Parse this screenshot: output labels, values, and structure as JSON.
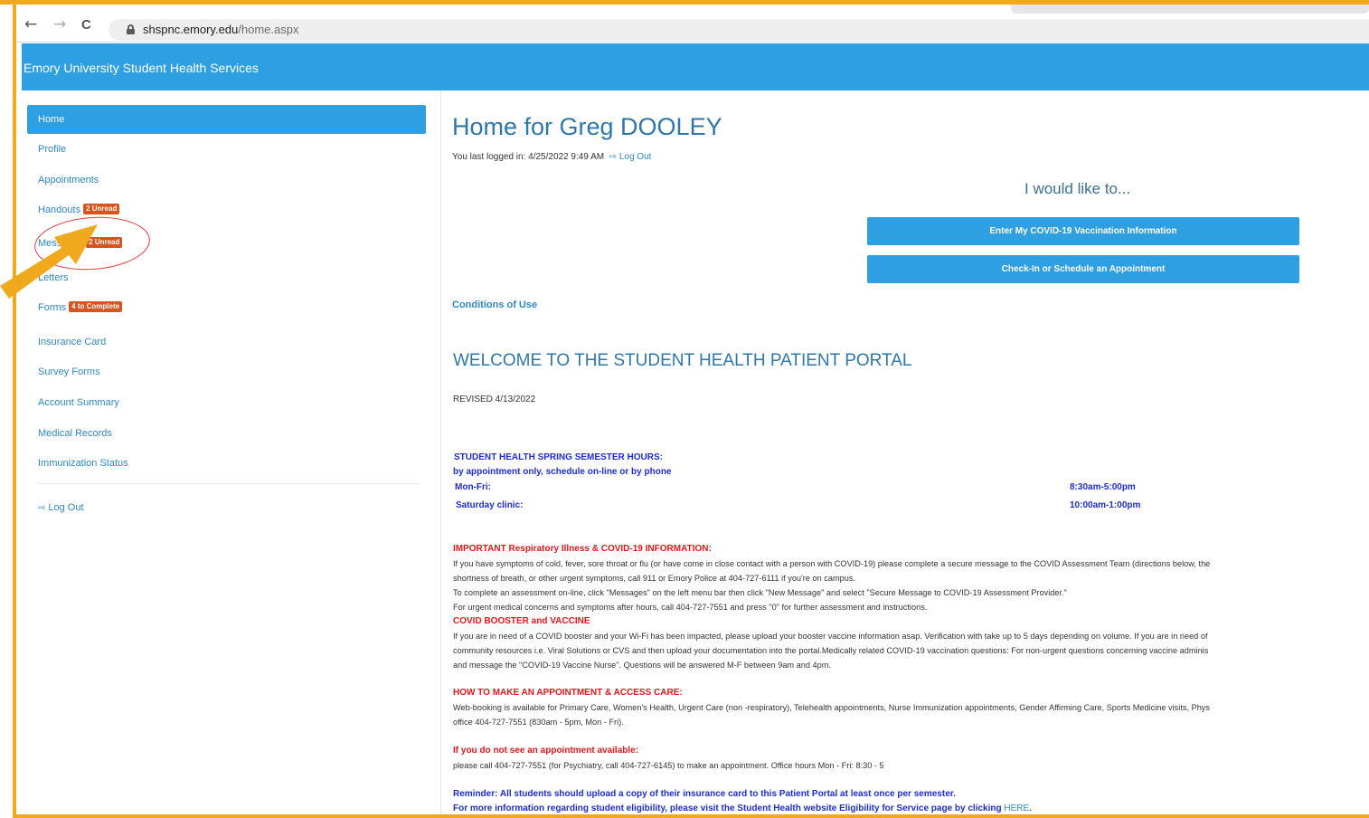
{
  "browser": {
    "back_icon": "←",
    "forward_icon": "→",
    "reload_icon": "C",
    "url_host": "shspnc.emory.edu",
    "url_path": "/home.aspx"
  },
  "app": {
    "title": "Emory University Student Health Services"
  },
  "sidebar": {
    "items": [
      {
        "label": "Home"
      },
      {
        "label": "Profile"
      },
      {
        "label": "Appointments"
      },
      {
        "label": "Handouts",
        "badge": "2 Unread"
      },
      {
        "label": "Messages",
        "badge": "2 Unread"
      },
      {
        "label": "Letters"
      },
      {
        "label": "Forms",
        "badge": "4 to Complete"
      },
      {
        "label": "Insurance Card"
      },
      {
        "label": "Survey Forms"
      },
      {
        "label": "Account Summary"
      },
      {
        "label": "Medical Records"
      },
      {
        "label": "Immunization Status"
      }
    ],
    "logout_label": "Log Out",
    "logout_icon": "⇨"
  },
  "main": {
    "page_title": "Home for Greg DOOLEY",
    "last_login_text": "You last logged in: 4/25/2022 9:49 AM",
    "last_login_logout": "Log Out",
    "would_like": "I would like to...",
    "btn_covid": "Enter My COVID-19 Vaccination Information",
    "btn_checkin": "Check-In or Schedule an Appointment",
    "conditions": "Conditions of Use",
    "welcome": "WELCOME TO THE STUDENT HEALTH PATIENT PORTAL",
    "revised": "REVISED 4/13/2022",
    "hours": {
      "heading": "STUDENT HEALTH SPRING SEMESTER HOURS:",
      "sub": "by appointment only, schedule on-line or by phone",
      "rows": [
        {
          "day": "Mon-Fri:",
          "time": "8:30am-5:00pm"
        },
        {
          "day": "Saturday clinic:",
          "time": "10:00am-1:00pm"
        }
      ]
    },
    "important": {
      "heading": "IMPORTANT Respiratory Illness & COVID-19 INFORMATION:",
      "lines": [
        "If you have symptoms of cold, fever, sore throat or flu (or have come in close contact with a person with COVID-19) please complete a secure message to the COVID Assessment Team (directions below, the",
        "shortness of breath, or other urgent symptoms, call 911 or Emory Police at 404-727-6111 if you're on campus.",
        "To complete an assessment on-line, click \"Messages\" on the left menu bar then click \"New Message\" and select \"Secure Message to COVID-19 Assessment Provider.\"",
        "For urgent medical concerns and symptoms after hours, call 404-727-7551 and press \"0\" for further assessment and instructions."
      ]
    },
    "booster": {
      "heading": "COVID BOOSTER and VACCINE",
      "lines": [
        "If you are in need of a COVID booster and your Wi-Fi has been impacted, please upload your booster vaccine information asap. Verification with take up to 5 days depending on volume. If you are in need of",
        "community resources i.e. Viral Solutions or CVS and then upload your documentation into the portal.Medically related COVID-19 vaccination questions: For non-urgent questions concerning vaccine adminis",
        "and message the \"COVID-19 Vaccine Nurse\". Questions will be answered M-F between 9am and 4pm."
      ]
    },
    "howto": {
      "heading": "HOW TO MAKE AN APPOINTMENT & ACCESS CARE:",
      "lines": [
        "Web-booking is available for Primary Care, Women's Health, Urgent Care (non -respiratory), Telehealth appointments, Nurse Immunization appointments, Gender Affirming Care, Sports Medicine visits, Phys",
        "office 404-727-7551 (830am - 5pm, Mon - Fri)."
      ]
    },
    "noappt": {
      "heading": "If you do not see an appointment available:",
      "line": "please call 404-727-7551 (for Psychiatry, call 404-727-6145) to make an appointment. Office hours Mon - Fri: 8:30 - 5"
    },
    "reminder": {
      "line1": "Reminder: All students should upload a copy of their insurance card to this Patient Portal at least once per semester.",
      "line2": "For more information regarding student eligibility, please visit the Student Health website Eligibility for Service page by clicking",
      "here": "HERE",
      "end": "."
    }
  },
  "colors": {
    "header_blue": "#2e9fe1",
    "badge_orange": "#d9531e",
    "annotation_orange": "#f0a81c",
    "annotation_red": "#e8393a"
  }
}
